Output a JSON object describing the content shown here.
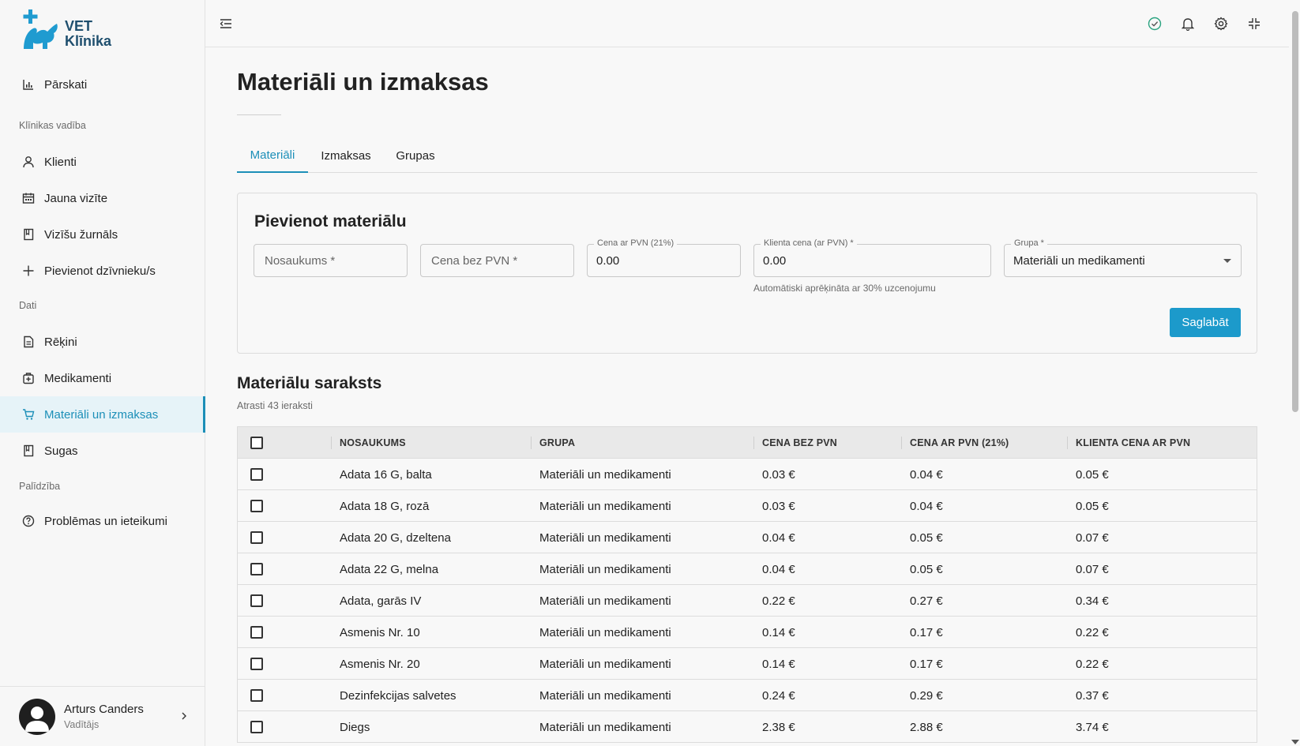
{
  "brand": {
    "line1": "VET",
    "line2": "Klīnika"
  },
  "sidebar": {
    "sections": {
      "management": "Klīnikas vadība",
      "data": "Dati",
      "help": "Palīdzība"
    },
    "items": {
      "reports": "Pārskati",
      "clients": "Klienti",
      "new_visit": "Jauna vizīte",
      "visit_log": "Vizīšu žurnāls",
      "add_animal": "Pievienot dzīvnieku/s",
      "invoices": "Rēķini",
      "medicines": "Medikamenti",
      "materials": "Materiāli un izmaksas",
      "species": "Sugas",
      "issues": "Problēmas un ieteikumi"
    },
    "active": "materials"
  },
  "user": {
    "name": "Arturs Canders",
    "role": "Vadītājs"
  },
  "page": {
    "title": "Materiāli un izmaksas",
    "tabs": {
      "materials": "Materiāli",
      "costs": "Izmaksas",
      "groups": "Grupas"
    }
  },
  "form": {
    "title": "Pievienot materiālu",
    "name_placeholder": "Nosaukums *",
    "price_placeholder": "Cena bez PVN *",
    "vat_label": "Cena ar PVN (21%)",
    "vat_value": "0.00",
    "client_label": "Klienta cena (ar PVN) *",
    "client_value": "0.00",
    "client_helper": "Automātiski aprēķināta ar 30% uzcenojumu",
    "group_label": "Grupa *",
    "group_value": "Materiāli un medikamenti",
    "save": "Saglabāt"
  },
  "list": {
    "title": "Materiālu saraksts",
    "count": "Atrasti 43 ieraksti",
    "headers": {
      "name": "NOSAUKUMS",
      "group": "GRUPA",
      "price": "CENA BEZ PVN",
      "vat": "CENA AR PVN (21%)",
      "client": "KLIENTA CENA AR PVN"
    },
    "rows": [
      {
        "name": "Adata 16 G, balta",
        "group": "Materiāli un medikamenti",
        "price": "0.03 €",
        "vat": "0.04 €",
        "client": "0.05 €"
      },
      {
        "name": "Adata 18 G, rozā",
        "group": "Materiāli un medikamenti",
        "price": "0.03 €",
        "vat": "0.04 €",
        "client": "0.05 €"
      },
      {
        "name": "Adata 20 G, dzeltena",
        "group": "Materiāli un medikamenti",
        "price": "0.04 €",
        "vat": "0.05 €",
        "client": "0.07 €"
      },
      {
        "name": "Adata 22 G, melna",
        "group": "Materiāli un medikamenti",
        "price": "0.04 €",
        "vat": "0.05 €",
        "client": "0.07 €"
      },
      {
        "name": "Adata, garās IV",
        "group": "Materiāli un medikamenti",
        "price": "0.22 €",
        "vat": "0.27 €",
        "client": "0.34 €"
      },
      {
        "name": "Asmenis Nr. 10",
        "group": "Materiāli un medikamenti",
        "price": "0.14 €",
        "vat": "0.17 €",
        "client": "0.22 €"
      },
      {
        "name": "Asmenis Nr. 20",
        "group": "Materiāli un medikamenti",
        "price": "0.14 €",
        "vat": "0.17 €",
        "client": "0.22 €"
      },
      {
        "name": "Dezinfekcijas salvetes",
        "group": "Materiāli un medikamenti",
        "price": "0.24 €",
        "vat": "0.29 €",
        "client": "0.37 €"
      },
      {
        "name": "Diegs",
        "group": "Materiāli un medikamenti",
        "price": "2.38 €",
        "vat": "2.88 €",
        "client": "3.74 €"
      }
    ]
  },
  "colors": {
    "accent": "#1c8fb8",
    "button": "#1c9acb",
    "brand": "#1f9bd0"
  },
  "icons": {
    "menu": "menu-collapse-icon",
    "status": "check-circle-icon",
    "bell": "bell-icon",
    "settings": "gear-icon",
    "fullscreen": "fullscreen-exit-icon"
  }
}
